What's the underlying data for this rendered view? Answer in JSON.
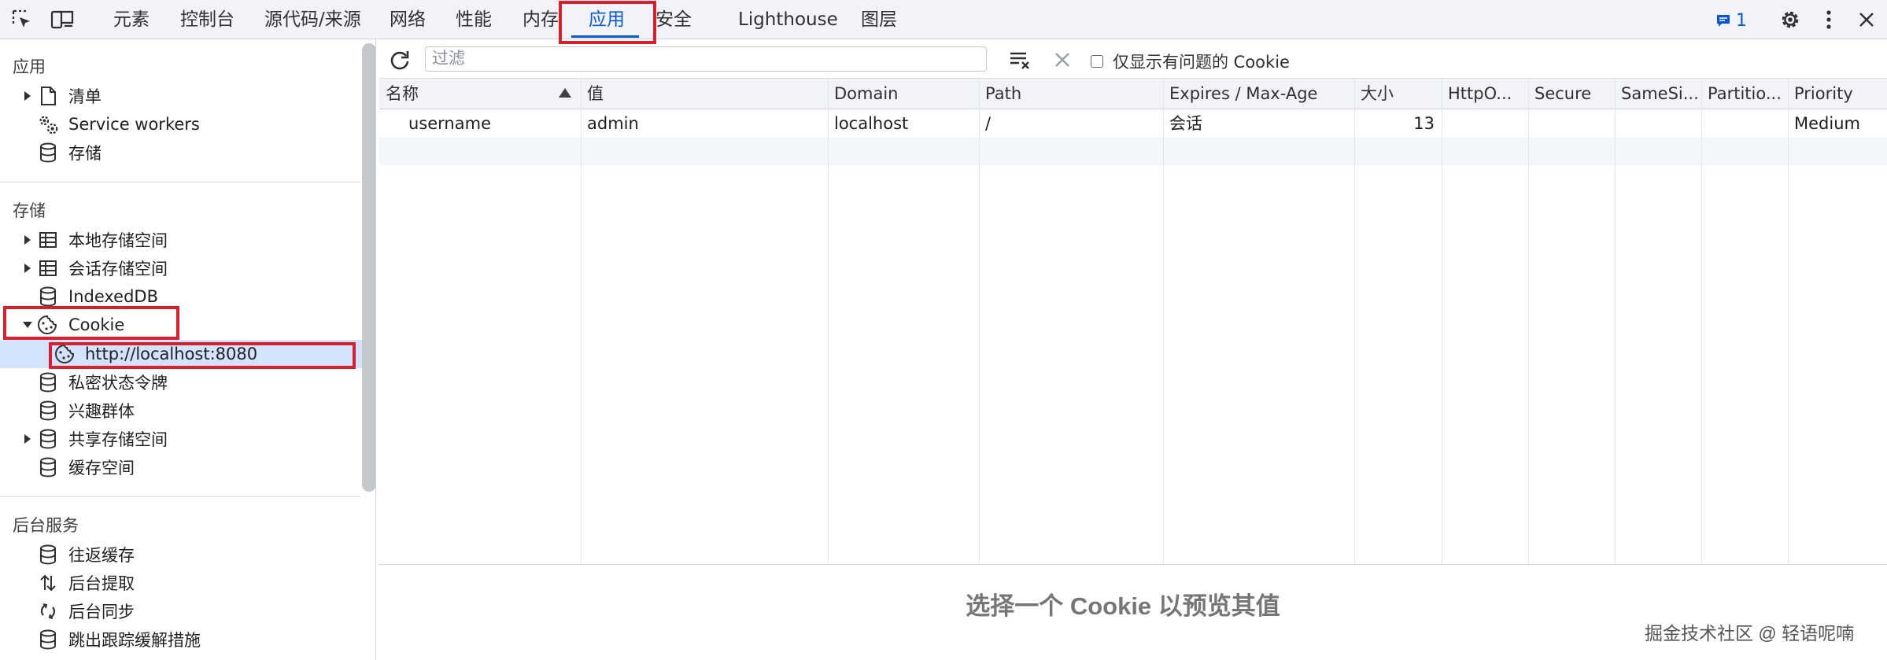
{
  "topbar": {
    "tabs": [
      {
        "label": "元素"
      },
      {
        "label": "控制台"
      },
      {
        "label": "源代码/来源"
      },
      {
        "label": "网络"
      },
      {
        "label": "性能"
      },
      {
        "label": "内存"
      },
      {
        "label": "应用"
      },
      {
        "label": "安全"
      },
      {
        "label": "Lighthouse"
      },
      {
        "label": "图层"
      }
    ],
    "active_tab": "应用",
    "issues_count": "1",
    "icons": [
      "inspect-element-icon",
      "device-toolbar-icon",
      "issues-icon",
      "settings-gear-icon",
      "more-vertical-icon",
      "close-icon"
    ],
    "accent_color": "#0b57d0",
    "highlight_color": "#d7212a"
  },
  "sidebar": {
    "sections": [
      {
        "title": "应用",
        "items": [
          {
            "label": "清单",
            "icon": "document-icon",
            "expandable": true
          },
          {
            "label": "Service workers",
            "icon": "gears-icon",
            "expandable": false
          },
          {
            "label": "存储",
            "icon": "database-icon",
            "expandable": false
          }
        ]
      },
      {
        "title": "存储",
        "items": [
          {
            "label": "本地存储空间",
            "icon": "table-icon",
            "expandable": true
          },
          {
            "label": "会话存储空间",
            "icon": "table-icon",
            "expandable": true
          },
          {
            "label": "IndexedDB",
            "icon": "database-icon",
            "expandable": false
          },
          {
            "label": "Cookie",
            "icon": "cookie-icon",
            "expandable": true,
            "expanded": true
          },
          {
            "label": "http://localhost:8080",
            "icon": "cookie-icon",
            "selected": true
          },
          {
            "label": "私密状态令牌",
            "icon": "database-icon",
            "expandable": false
          },
          {
            "label": "兴趣群体",
            "icon": "database-icon",
            "expandable": false
          },
          {
            "label": "共享存储空间",
            "icon": "database-icon",
            "expandable": true
          },
          {
            "label": "缓存空间",
            "icon": "database-icon",
            "expandable": false
          }
        ]
      },
      {
        "title": "后台服务",
        "items": [
          {
            "label": "往返缓存",
            "icon": "database-icon"
          },
          {
            "label": "后台提取",
            "icon": "up-down-arrows-icon"
          },
          {
            "label": "后台同步",
            "icon": "sync-icon"
          },
          {
            "label": "跳出跟踪缓解措施",
            "icon": "database-icon"
          }
        ]
      }
    ]
  },
  "toolbar": {
    "filter_placeholder": "过滤",
    "only_issues_label": "仅显示有问题的 Cookie",
    "icons": [
      "refresh-icon",
      "clear-filtered-icon",
      "delete-selected-icon"
    ]
  },
  "cookies_table": {
    "columns": [
      "名称",
      "值",
      "Domain",
      "Path",
      "Expires / Max-Age",
      "大小",
      "HttpO...",
      "Secure",
      "SameSi...",
      "Partitio...",
      "Priority"
    ],
    "sorted_column": "名称",
    "sort_direction": "ascending",
    "rows": [
      [
        "username",
        "admin",
        "localhost",
        "/",
        "会话",
        "13",
        "",
        "",
        "",
        "",
        "Medium"
      ]
    ]
  },
  "preview": {
    "message": "选择一个 Cookie 以预览其值"
  },
  "watermark": "掘金技术社区 @ 轻语呢喃"
}
